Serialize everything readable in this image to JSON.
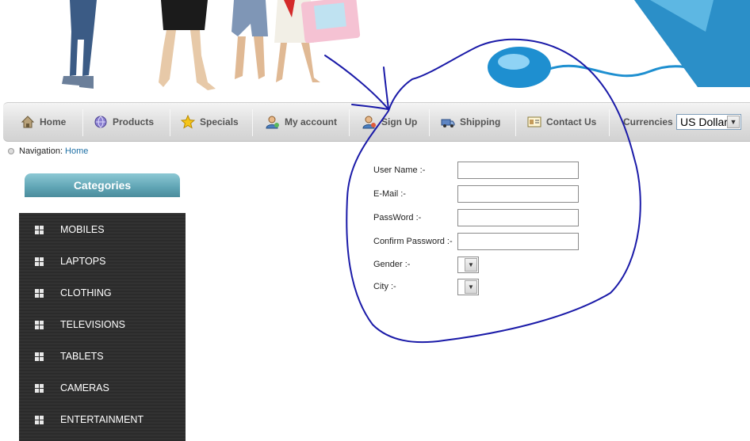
{
  "nav": {
    "items": [
      {
        "label": "Home",
        "icon": "house-icon"
      },
      {
        "label": "Products",
        "icon": "products-globe-icon"
      },
      {
        "label": "Specials",
        "icon": "star-icon"
      },
      {
        "label": "My account",
        "icon": "user-account-icon"
      },
      {
        "label": "Sign Up",
        "icon": "user-signup-icon"
      },
      {
        "label": "Shipping",
        "icon": "truck-icon"
      },
      {
        "label": "Contact Us",
        "icon": "contact-card-icon"
      }
    ],
    "currencies_label": "Currencies",
    "currency_selected": "US Dollar"
  },
  "breadcrumb": {
    "label": "Navigation:",
    "link": "Home"
  },
  "categories": {
    "title": "Categories",
    "items": [
      "MOBILES",
      "LAPTOPS",
      "CLOTHING",
      "TELEVISIONS",
      "TABLETS",
      "CAMERAS",
      "ENTERTAINMENT"
    ]
  },
  "signup_form": {
    "username_label": "User Name :-",
    "email_label": "E-Mail :-",
    "password_label": "PassWord :-",
    "confirm_password_label": "Confirm Password :-",
    "gender_label": "Gender :-",
    "city_label": "City :-",
    "username_value": "",
    "email_value": "",
    "password_value": "",
    "confirm_password_value": ""
  },
  "colors": {
    "nav_text": "#555555",
    "category_header": "#5fa4b4",
    "category_panel": "#2e2e2e",
    "link": "#1d6fa5",
    "annotation_ink": "#1a1aa8"
  }
}
